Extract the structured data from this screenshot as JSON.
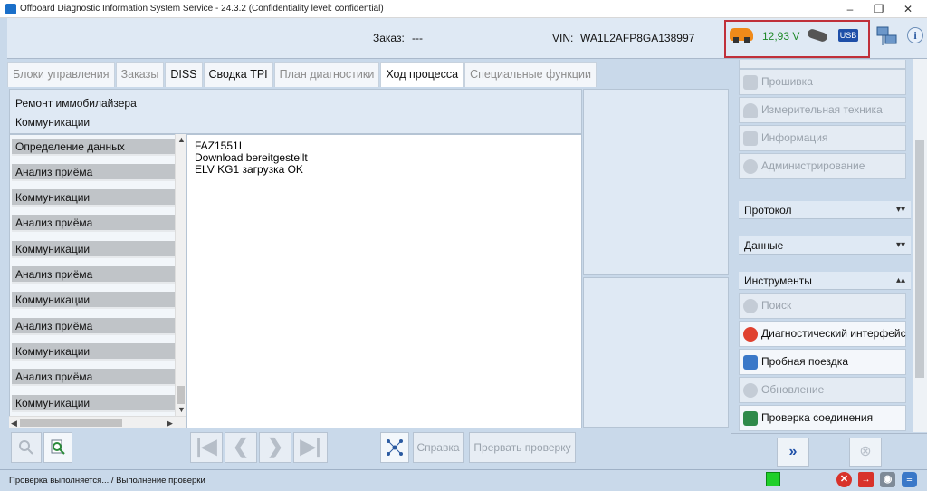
{
  "window": {
    "title": "Offboard Diagnostic Information System Service - 24.3.2 (Confidentiality level: confidential)",
    "controls": [
      "–",
      "❐",
      "✕"
    ]
  },
  "header": {
    "order_label": "Заказ:",
    "order_value": "---",
    "vin_label": "VIN:",
    "vin_value": "WA1L2AFP8GA138997",
    "voltage": "12,93 V",
    "usb_label": "USB",
    "info_glyph": "i"
  },
  "tabs": [
    {
      "label": "Блоки управления",
      "state": "disabled"
    },
    {
      "label": "Заказы",
      "state": "disabled"
    },
    {
      "label": "DISS",
      "state": "enabled"
    },
    {
      "label": "Сводка TPI",
      "state": "enabled"
    },
    {
      "label": "План диагностики",
      "state": "disabled"
    },
    {
      "label": "Ход процесса",
      "state": "active"
    },
    {
      "label": "Специальные функции",
      "state": "disabled"
    }
  ],
  "process": {
    "title": "Ремонт иммобилайзера",
    "subtitle": "Коммуникации"
  },
  "steps": [
    "Определение данных",
    "Анализ приёма",
    "Коммуникации",
    "Анализ приёма",
    "Коммуникации",
    "Анализ приёма",
    "Коммуникации",
    "Анализ приёма",
    "Коммуникации",
    "Анализ приёма",
    "Коммуникации"
  ],
  "log_lines": [
    "FAZ1551I",
    "Download bereitgestellt",
    "ELV KG1 загрузка OK"
  ],
  "toolbar": {
    "help_label": "Справка",
    "abort_label": "Прервать проверку"
  },
  "sidebar": {
    "top_buttons": [
      {
        "label": "Прошивка",
        "enabled": false
      },
      {
        "label": "Измерительная техника",
        "enabled": false
      },
      {
        "label": "Информация",
        "enabled": false
      },
      {
        "label": "Администрирование",
        "enabled": false
      }
    ],
    "sections": [
      {
        "label": "Протокол",
        "chevron": "▾▾"
      },
      {
        "label": "Данные",
        "chevron": "▾▾"
      },
      {
        "label": "Инструменты",
        "chevron": "▴▴"
      }
    ],
    "tool_buttons": [
      {
        "label": "Поиск",
        "enabled": false
      },
      {
        "label": "Диагностический интерфейс",
        "enabled": true
      },
      {
        "label": "Пробная поездка",
        "enabled": true
      },
      {
        "label": "Обновление",
        "enabled": false
      },
      {
        "label": "Проверка соединения",
        "enabled": true
      }
    ]
  },
  "statusbar": {
    "text": "Проверка выполняется... / Выполнение проверки"
  },
  "colors": {
    "accent_blue": "#1e4fa8",
    "voltage_green": "#1f8a2a",
    "highlight_red": "#c0303a",
    "status_green": "#1fcf2a"
  }
}
